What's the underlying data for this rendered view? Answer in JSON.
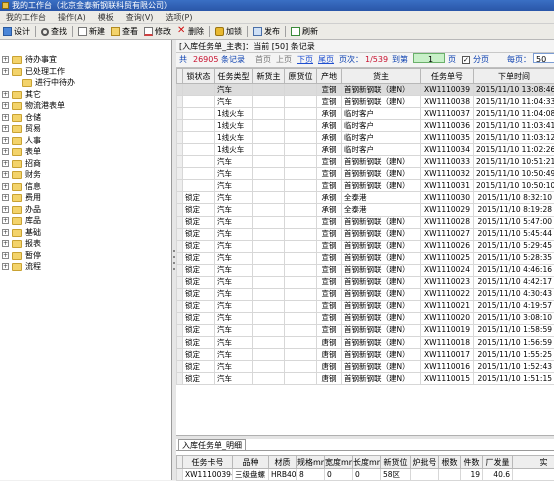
{
  "window": {
    "title": "我的工作台（北京金泰新钢联科贸有限公司）"
  },
  "menu": [
    "我的工作台",
    "操作(A)",
    "模板",
    "查询(V)",
    "选项(P)"
  ],
  "toolbar": [
    {
      "label": "设计",
      "icon": "design-icon"
    },
    {
      "label": "查找",
      "icon": "search-icon"
    },
    {
      "label": "新建",
      "icon": "new-doc-icon"
    },
    {
      "label": "查看",
      "icon": "view-icon"
    },
    {
      "label": "修改",
      "icon": "edit-icon"
    },
    {
      "label": "删除",
      "icon": "delete-icon"
    },
    {
      "label": "加锁",
      "icon": "lock-icon"
    },
    {
      "label": "发布",
      "icon": "publish-icon"
    },
    {
      "label": "刷新",
      "icon": "refresh-icon"
    }
  ],
  "sidebar": {
    "items": [
      {
        "label": "待办事宜",
        "expander": "+"
      },
      {
        "label": "已处理工作",
        "expander": "+"
      },
      {
        "label": "进行中待办",
        "expander": ""
      },
      {
        "label": "其它",
        "expander": "+"
      },
      {
        "label": "物流港表单",
        "expander": "+"
      },
      {
        "label": "仓储",
        "expander": "+"
      },
      {
        "label": "贸易",
        "expander": "+"
      },
      {
        "label": "人事",
        "expander": "+"
      },
      {
        "label": "表单",
        "expander": "+"
      },
      {
        "label": "招商",
        "expander": "+"
      },
      {
        "label": "财务",
        "expander": "+"
      },
      {
        "label": "信息",
        "expander": "+"
      },
      {
        "label": "费用",
        "expander": "+"
      },
      {
        "label": "办品",
        "expander": "+"
      },
      {
        "label": "库品",
        "expander": "+"
      },
      {
        "label": "基础",
        "expander": "+"
      },
      {
        "label": "报表",
        "expander": "+"
      },
      {
        "label": "暂停",
        "expander": "+"
      },
      {
        "label": "流程",
        "expander": "+"
      }
    ]
  },
  "main": {
    "title": "[入库任务单_主表]：当前 [50] 条记录",
    "pager": {
      "total_label": "共",
      "total": "26905",
      "total_unit": "条记录",
      "first": "首页",
      "prev": "上页",
      "next": "下页",
      "last": "尾页",
      "pages_label": "页次：",
      "pages": "1/539",
      "goto_label": "到第",
      "goto_value": "1",
      "page_unit": "页",
      "paged_label": "分页",
      "per_page_label": "每页：",
      "per_page_value": "50"
    },
    "columns": [
      "",
      "锁状态",
      "任务类型",
      "新货主",
      "原货位",
      "产地",
      "货主",
      "任务单号",
      "下单时间"
    ],
    "rows": [
      [
        "",
        "汽车",
        "",
        "",
        "宣钢",
        "首钢新钢联（建N）",
        "XW1110039",
        "2015/11/10 13:08:46"
      ],
      [
        "",
        "汽车",
        "",
        "",
        "宣钢",
        "首钢新钢联（建N）",
        "XW1110038",
        "2015/11/10 11:04:33"
      ],
      [
        "",
        "1线火车",
        "",
        "",
        "承钢",
        "临时客户",
        "XW1110037",
        "2015/11/10 11:04:08"
      ],
      [
        "",
        "1线火车",
        "",
        "",
        "承钢",
        "临时客户",
        "XW1110036",
        "2015/11/10 11:03:41"
      ],
      [
        "",
        "1线火车",
        "",
        "",
        "承钢",
        "临时客户",
        "XW1110035",
        "2015/11/10 11:03:12"
      ],
      [
        "",
        "1线火车",
        "",
        "",
        "承钢",
        "临时客户",
        "XW1110034",
        "2015/11/10 11:02:26"
      ],
      [
        "",
        "汽车",
        "",
        "",
        "宣钢",
        "首钢新钢联（建N）",
        "XW1110033",
        "2015/11/10 10:51:21"
      ],
      [
        "",
        "汽车",
        "",
        "",
        "宣钢",
        "首钢新钢联（建N）",
        "XW1110032",
        "2015/11/10 10:50:49"
      ],
      [
        "",
        "汽车",
        "",
        "",
        "宣钢",
        "首钢新钢联（建N）",
        "XW1110031",
        "2015/11/10 10:50:10"
      ],
      [
        "锁定",
        "汽车",
        "",
        "",
        "承钢",
        "全泰港",
        "XW1110030",
        "2015/11/10 8:32:10"
      ],
      [
        "锁定",
        "汽车",
        "",
        "",
        "承钢",
        "全泰港",
        "XW1110029",
        "2015/11/10 8:19:28"
      ],
      [
        "锁定",
        "汽车",
        "",
        "",
        "宣钢",
        "首钢新钢联（建N）",
        "XW1110028",
        "2015/11/10 5:47:00"
      ],
      [
        "锁定",
        "汽车",
        "",
        "",
        "宣钢",
        "首钢新钢联（建N）",
        "XW1110027",
        "2015/11/10 5:45:44"
      ],
      [
        "锁定",
        "汽车",
        "",
        "",
        "宣钢",
        "首钢新钢联（建N）",
        "XW1110026",
        "2015/11/10 5:29:45"
      ],
      [
        "锁定",
        "汽车",
        "",
        "",
        "宣钢",
        "首钢新钢联（建N）",
        "XW1110025",
        "2015/11/10 5:28:35"
      ],
      [
        "锁定",
        "汽车",
        "",
        "",
        "宣钢",
        "首钢新钢联（建N）",
        "XW1110024",
        "2015/11/10 4:46:16"
      ],
      [
        "锁定",
        "汽车",
        "",
        "",
        "宣钢",
        "首钢新钢联（建N）",
        "XW1110023",
        "2015/11/10 4:42:17"
      ],
      [
        "锁定",
        "汽车",
        "",
        "",
        "宣钢",
        "首钢新钢联（建N）",
        "XW1110022",
        "2015/11/10 4:30:43"
      ],
      [
        "锁定",
        "汽车",
        "",
        "",
        "宣钢",
        "首钢新钢联（建N）",
        "XW1110021",
        "2015/11/10 4:19:57"
      ],
      [
        "锁定",
        "汽车",
        "",
        "",
        "宣钢",
        "首钢新钢联（建N）",
        "XW1110020",
        "2015/11/10 3:08:10"
      ],
      [
        "锁定",
        "汽车",
        "",
        "",
        "宣钢",
        "首钢新钢联（建N）",
        "XW1110019",
        "2015/11/10 1:58:59"
      ],
      [
        "锁定",
        "汽车",
        "",
        "",
        "唐钢",
        "首钢新钢联（建N）",
        "XW1110018",
        "2015/11/10 1:56:59"
      ],
      [
        "锁定",
        "汽车",
        "",
        "",
        "唐钢",
        "首钢新钢联（建N）",
        "XW1110017",
        "2015/11/10 1:55:25"
      ],
      [
        "锁定",
        "汽车",
        "",
        "",
        "唐钢",
        "首钢新钢联（建N）",
        "XW1110016",
        "2015/11/10 1:52:43"
      ],
      [
        "锁定",
        "汽车",
        "",
        "",
        "唐钢",
        "首钢新钢联（建N）",
        "XW1110015",
        "2015/11/10 1:51:15"
      ]
    ],
    "detail": {
      "tab": "入库任务单_明细",
      "columns": [
        "任务卡号",
        "品种",
        "材质",
        "规格mm",
        "宽度mm",
        "长度mm",
        "新货位",
        "炉批号",
        "根数",
        "件数",
        "厂发量",
        "实"
      ],
      "rows": [
        [
          "XW1110039-1",
          "三级盘螺",
          "HRB400",
          "8",
          "0",
          "0",
          "58区",
          "",
          "",
          "19",
          "40.6",
          ""
        ]
      ]
    }
  },
  "colors": {
    "titlebar": "#2a56a8",
    "folder": "#f3d36b",
    "pager_red": "#c8102e",
    "pager_blue": "#1f4fd0",
    "selected_row": "#dcdcdc"
  }
}
